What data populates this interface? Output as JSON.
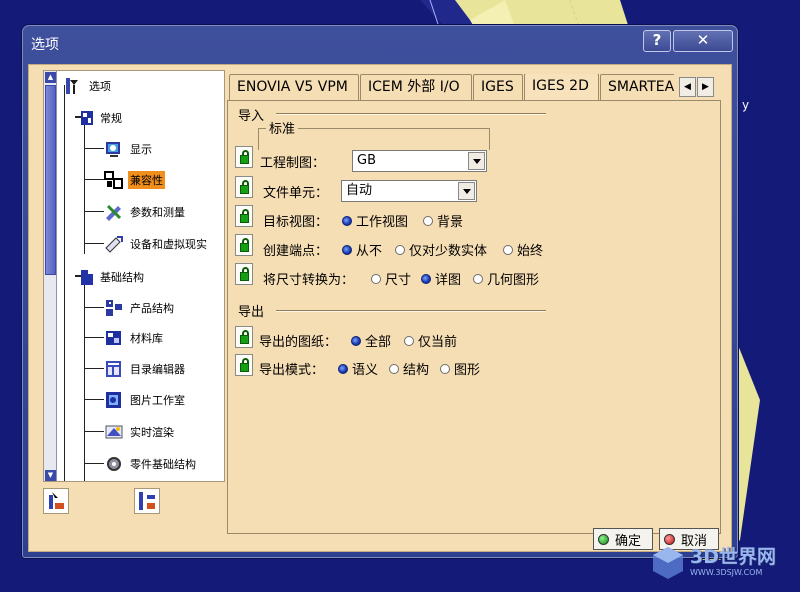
{
  "background": {
    "axis_label": "y",
    "watermark": "3D世界网",
    "watermark_url": "WWW.3DSJW.COM"
  },
  "dialog": {
    "title": "选项",
    "help_button": "?",
    "close_button": "✕"
  },
  "tree": {
    "items": [
      {
        "label": "选项",
        "icon": "options-icon"
      },
      {
        "label": "常规",
        "icon": "general-icon"
      },
      {
        "label": "显示",
        "icon": "display-icon"
      },
      {
        "label": "兼容性",
        "icon": "compatibility-icon",
        "selected": true
      },
      {
        "label": "参数和测量",
        "icon": "parameters-icon"
      },
      {
        "label": "设备和虚拟现实",
        "icon": "devices-icon"
      },
      {
        "label": "基础结构",
        "icon": "infrastructure-icon"
      },
      {
        "label": "产品结构",
        "icon": "product-structure-icon"
      },
      {
        "label": "材料库",
        "icon": "material-library-icon"
      },
      {
        "label": "目录编辑器",
        "icon": "catalog-editor-icon"
      },
      {
        "label": "图片工作室",
        "icon": "photo-studio-icon"
      },
      {
        "label": "实时渲染",
        "icon": "realtime-render-icon"
      },
      {
        "label": "零件基础结构",
        "icon": "part-infrastructure-icon"
      }
    ]
  },
  "tabs": [
    "ENOVIA V5 VPM",
    "ICEM 外部 I/O",
    "IGES",
    "IGES 2D",
    "SMARTEAM"
  ],
  "active_tab": "IGES 2D",
  "import": {
    "section": "导入",
    "group": "标准",
    "drawing_standard": {
      "label": "工程制图：",
      "value": "GB"
    },
    "file_unit": {
      "label": "文件单元：",
      "value": "自动"
    },
    "target_view": {
      "label": "目标视图：",
      "options": [
        "工作视图",
        "背景"
      ],
      "selected": 0
    },
    "create_endpoints": {
      "label": "创建端点：",
      "options": [
        "从不",
        "仅对少数实体",
        "始终"
      ],
      "selected": 0
    },
    "convert_dims": {
      "label": "将尺寸转换为：",
      "options": [
        "尺寸",
        "详图",
        "几何图形"
      ],
      "selected": 1
    }
  },
  "export": {
    "section": "导出",
    "sheets": {
      "label": "导出的图纸：",
      "options": [
        "全部",
        "仅当前"
      ],
      "selected": 0
    },
    "mode": {
      "label": "导出模式：",
      "options": [
        "语义",
        "结构",
        "图形"
      ],
      "selected": 0
    }
  },
  "buttons": {
    "ok": "确定",
    "cancel": "取消"
  },
  "colors": {
    "panel_bg": "#f5ddb4",
    "selection": "#f08f1c",
    "title_bar": "#3e4f9c",
    "scene_bg": "#141a78"
  }
}
